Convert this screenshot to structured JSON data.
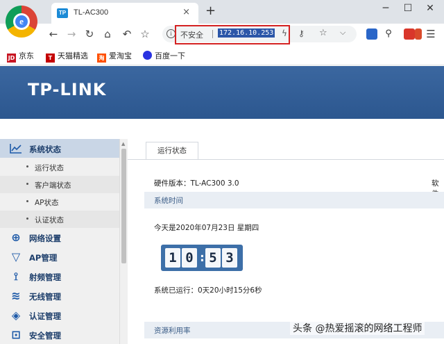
{
  "browser": {
    "tab_favicon": "TP",
    "tab_title": "TL-AC300",
    "tab_close": "×",
    "new_tab": "+",
    "win_minimize": "─",
    "win_maximize": "☐",
    "win_close": "✕"
  },
  "toolbar": {
    "back": "←",
    "forward": "→",
    "reload": "↻",
    "home": "⌂",
    "undo": "↶",
    "bookmark_star": "☆",
    "info": "i",
    "security_label": "不安全",
    "url": "172.16.10.253",
    "menu": "☰"
  },
  "bookmarks": [
    {
      "icon_text": "JD",
      "label": "京东",
      "color": "#c81623"
    },
    {
      "icon_text": "T",
      "label": "天猫精选",
      "color": "#c40000"
    },
    {
      "icon_text": "淘",
      "label": "爱淘宝",
      "color": "#ff5000"
    },
    {
      "icon_text": "",
      "label": "百度一下",
      "color": "#2932e1"
    }
  ],
  "banner": {
    "brand": "TP-LINK"
  },
  "sidebar": {
    "active_menu": "系统状态",
    "submenu": [
      "运行状态",
      "客户端状态",
      "AP状态",
      "认证状态"
    ],
    "menus": [
      {
        "label": "网络设置",
        "icon": "globe-icon"
      },
      {
        "label": "AP管理",
        "icon": "ap-icon"
      },
      {
        "label": "射频管理",
        "icon": "antenna-icon"
      },
      {
        "label": "无线管理",
        "icon": "wifi-icon"
      },
      {
        "label": "认证管理",
        "icon": "shield-icon"
      },
      {
        "label": "安全管理",
        "icon": "lock-icon"
      }
    ]
  },
  "content": {
    "tab": "运行状态",
    "hardware_version": "硬件版本：TL-AC300 3.0",
    "software_version_cut": "软件",
    "section_time": "系统时间",
    "date": "今天是2020年07月23日 星期四",
    "clock_digits": [
      "1",
      "0",
      "5",
      "3"
    ],
    "clock_sep": ":",
    "uptime": "系统已运行：0天20小时15分6秒",
    "section_resources": "资源利用率"
  },
  "watermark": "头条 @热爱摇滚的网络工程师",
  "colors": {
    "banner": "#2f5b93",
    "sidebar_active": "#c9d6e6",
    "url_highlight_border": "#d42222"
  }
}
